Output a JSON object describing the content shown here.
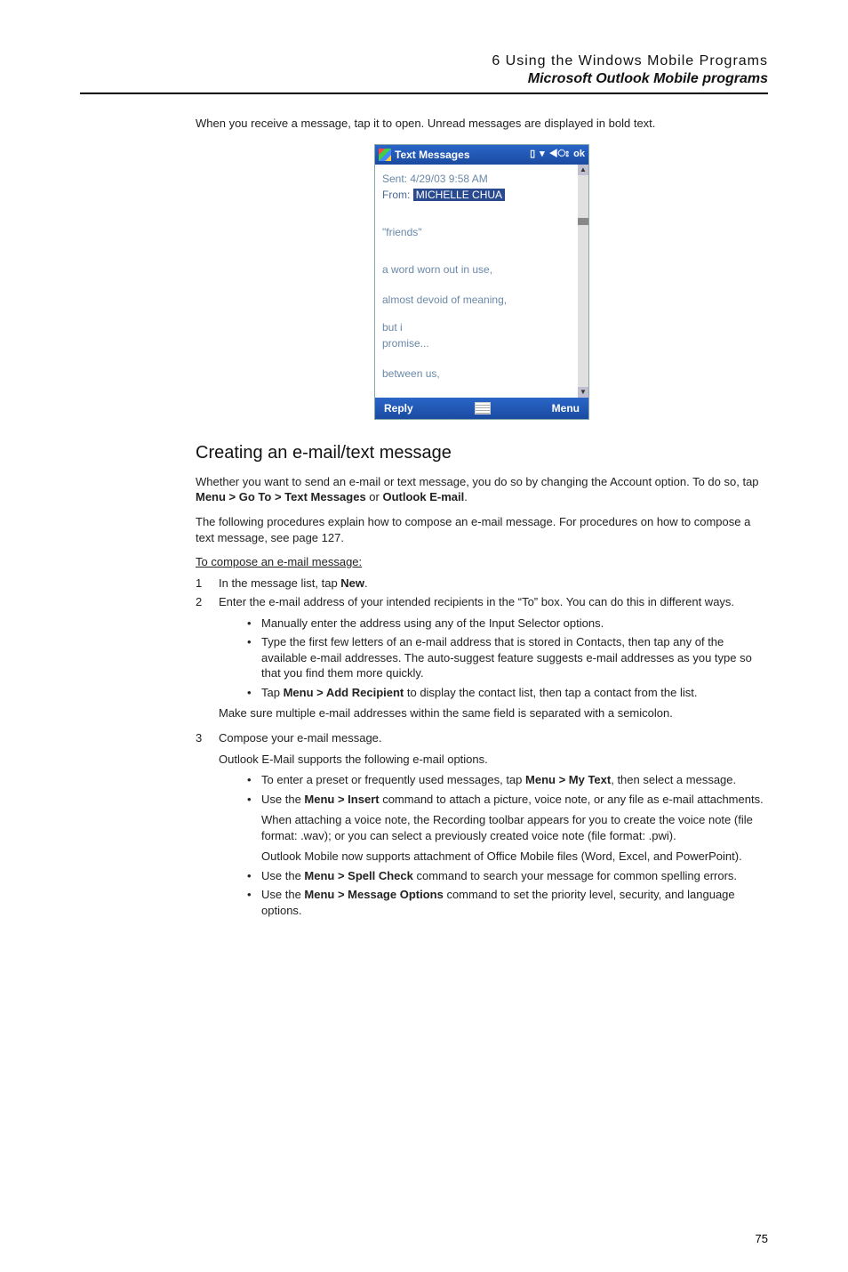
{
  "header": {
    "chapter": "6 Using the Windows Mobile Programs",
    "section": "Microsoft Outlook Mobile programs"
  },
  "intro": "When you receive a message, tap it to open. Unread messages are displayed in bold text.",
  "phone": {
    "title": "Text Messages",
    "status_ok": "ok",
    "sent_label": "Sent:",
    "sent_value": "4/29/03 9:58 AM",
    "from_label": "From:",
    "from_name": "MICHELLE CHUA",
    "lines": {
      "l1": "\"friends\"",
      "l2": "a word worn out in use,",
      "l3": "almost devoid of meaning,",
      "l4": "but i",
      "l5": "promise...",
      "l6": "between us,"
    },
    "reply": "Reply",
    "menu": "Menu"
  },
  "subhead": "Creating an e-mail/text message",
  "p1a": "Whether you want to send an e-mail or text message, you do so by changing the Account option. To do so, tap ",
  "p1b": "Menu > Go To > Text Messages",
  "p1c": " or ",
  "p1d": "Outlook E-mail",
  "p1e": ".",
  "p2": "The following procedures explain how to compose an e-mail message. For procedures on how to compose a text message, see page 127.",
  "proc_head": "To compose an e-mail message:",
  "s1": {
    "num": "1",
    "a": "In the message list, tap ",
    "b": "New",
    "c": "."
  },
  "s2": {
    "num": "2",
    "text": "Enter the e-mail address of your intended recipients in the “To” box. You can do this in different ways.",
    "b1": "Manually enter the address using any of the Input Selector options.",
    "b2": "Type the first few letters of an e-mail address that is stored in Contacts, then tap any of the available e-mail addresses. The auto-suggest feature suggests e-mail addresses as you type so that you find them more quickly.",
    "b3a": "Tap ",
    "b3b": "Menu > Add Recipient",
    "b3c": " to display the contact list, then tap a contact from the list.",
    "tail": "Make sure multiple e-mail addresses within the same field is separated with a semicolon."
  },
  "s3": {
    "num": "3",
    "text": "Compose your e-mail message.",
    "sub": "Outlook E-Mail supports the following e-mail options.",
    "c1a": "To enter a preset or frequently used messages, tap ",
    "c1b": "Menu > My Text",
    "c1c": ", then select a message.",
    "c2a": "Use the ",
    "c2b": "Menu > Insert",
    "c2c": " command to attach a picture, voice note, or any file as e-mail attachments.",
    "c2n1": "When attaching a voice note, the Recording toolbar appears for you to create the voice note (file format: .wav); or you can select a previously created voice note (file format: .pwi).",
    "c2n2": "Outlook Mobile now supports attachment of Office Mobile files (Word, Excel, and PowerPoint).",
    "c3a": "Use the ",
    "c3b": "Menu > Spell Check",
    "c3c": " command to search your message for common spelling errors.",
    "c4a": "Use the ",
    "c4b": "Menu > Message Options",
    "c4c": " command to set the priority level, security, and language options."
  },
  "page_num": "75"
}
